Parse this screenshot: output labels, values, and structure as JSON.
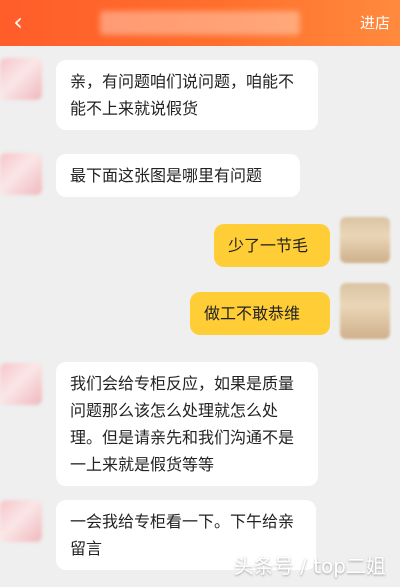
{
  "header": {
    "back_label": "‹",
    "enter_store": "进店"
  },
  "messages": [
    {
      "side": "left",
      "text": "亲，有问题咱们说问题，咱能不能不上来就说假货"
    },
    {
      "side": "left",
      "text": "最下面这张图是哪里有问题"
    },
    {
      "side": "right",
      "text": "少了一节毛"
    },
    {
      "side": "right",
      "text": "做工不敢恭维"
    },
    {
      "side": "left",
      "text": "我们会给专柜反应，如果是质量问题那么该怎么处理就怎么处理。但是请亲先和我们沟通不是一上来就是假货等等"
    },
    {
      "side": "left",
      "text": "一会我给专柜看一下。下午给亲留言"
    }
  ],
  "watermark": "头条号 / top二姐"
}
